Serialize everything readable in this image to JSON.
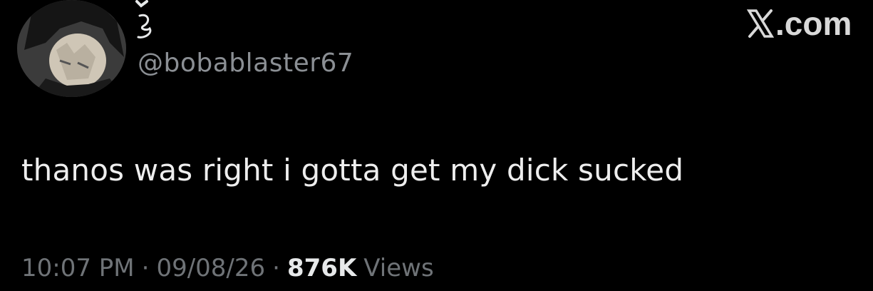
{
  "user": {
    "handle": "@bobablaster67"
  },
  "brand": {
    "logo_text": ".com"
  },
  "tweet": {
    "text": "thanos was right i gotta get my dick sucked"
  },
  "meta": {
    "time": "10:07 PM",
    "date": "09/08/26",
    "separator": "·",
    "views_count": "876K",
    "views_label": "Views"
  },
  "icons": {
    "avatar": "avatar-image",
    "display_name": "display-name-glyph",
    "logo": "x-logo-icon"
  },
  "colors": {
    "background": "#000000",
    "text": "#e7e9ea",
    "secondary": "#6f7377"
  }
}
